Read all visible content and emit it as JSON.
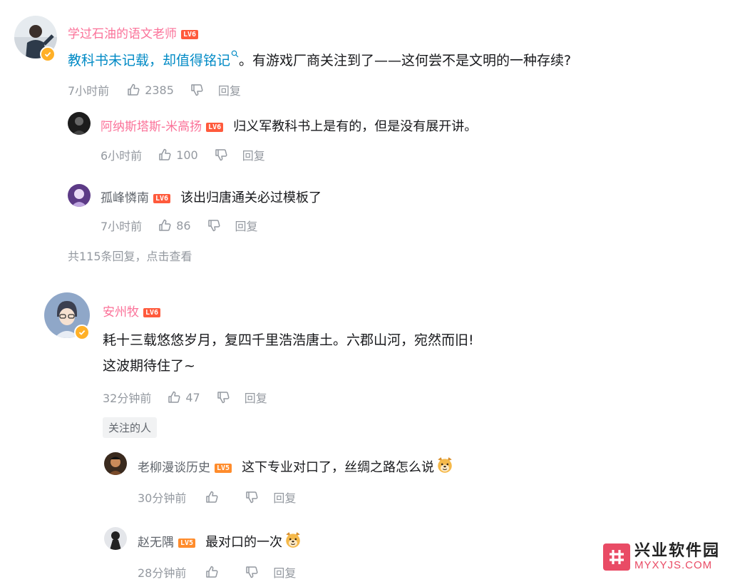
{
  "comments": [
    {
      "user": "学过石油的语文老师",
      "level": "LV6",
      "text_link": "教科书未记载，却值得铭记",
      "text_rest": "。有游戏厂商关注到了——这何尝不是文明的一种存续?",
      "time": "7小时前",
      "likes": "2385",
      "reply_label": "回复",
      "replies": [
        {
          "user": "阿纳斯塔斯-米高扬",
          "level": "LV6",
          "text": "归义军教科书上是有的，但是没有展开讲。",
          "time": "6小时前",
          "likes": "100",
          "reply_label": "回复"
        },
        {
          "user": "孤峰憐南",
          "level": "LV6",
          "text": "该出归唐通关必过模板了",
          "time": "7小时前",
          "likes": "86",
          "reply_label": "回复"
        }
      ],
      "more_replies": "共115条回复，点击查看"
    },
    {
      "user": "安州牧",
      "level": "LV6",
      "text_line1": "耗十三载悠悠岁月，复四千里浩浩唐土。六郡山河，宛然而旧!",
      "text_line2": "这波期待住了~",
      "time": "32分钟前",
      "likes": "47",
      "reply_label": "回复",
      "tag": "关注的人",
      "replies": [
        {
          "user": "老柳漫谈历史",
          "level": "LV5",
          "text": "这下专业对口了，丝绸之路怎么说",
          "time": "30分钟前",
          "reply_label": "回复"
        },
        {
          "user": "赵无隅",
          "level": "LV5",
          "text": "最对口的一次",
          "time": "28分钟前",
          "reply_label": "回复"
        }
      ]
    }
  ],
  "watermark": {
    "name": "兴业软件园",
    "url": "MYXYJS.COM"
  },
  "colors": {
    "username": "#fb7299",
    "link": "#008ac5",
    "meta": "#9499a0",
    "level6": "#ff5a3c",
    "level5": "#ff8c2c"
  },
  "icons": [
    "thumbs-up-icon",
    "thumbs-down-icon",
    "search-icon",
    "verified-badge-icon",
    "dog-emoji-icon"
  ]
}
